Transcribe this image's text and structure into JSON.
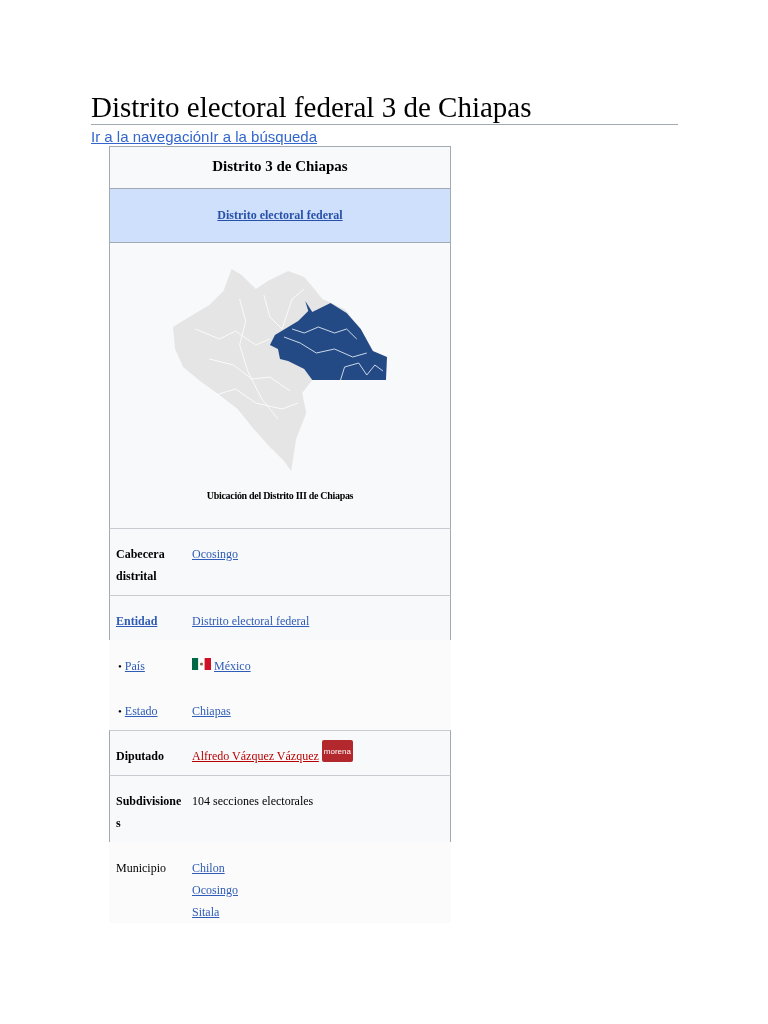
{
  "page": {
    "title": "Distrito electoral federal 3 de Chiapas",
    "skip_links": [
      "Ir a la navegación",
      "Ir a la búsqueda"
    ]
  },
  "infobox": {
    "title": "Distrito 3 de Chiapas",
    "subtitle_link": "Distrito electoral federal",
    "map": {
      "caption": "Ubicación del Distrito III de Chiapas"
    },
    "rows": [
      {
        "label": "Cabecera distrital",
        "kind": "bold",
        "framed": true,
        "values": [
          {
            "text": "Ocosingo",
            "kind": "link"
          }
        ]
      },
      {
        "label": "Entidad",
        "kind": "boldlink",
        "framed": true,
        "values": [
          {
            "text": "Distrito electoral federal",
            "kind": "link"
          }
        ]
      },
      {
        "bullet": "•",
        "label": "País",
        "kind": "link",
        "framed": false,
        "values": [
          {
            "text": "México",
            "kind": "link",
            "flag": true
          }
        ]
      },
      {
        "bullet": "•",
        "label": "Estado",
        "kind": "link",
        "framed": false,
        "values": [
          {
            "text": "Chiapas",
            "kind": "link"
          }
        ]
      },
      {
        "label": "Diputado",
        "kind": "bold",
        "framed": true,
        "values": [
          {
            "text": "Alfredo Vázquez Vázquez",
            "kind": "redlink",
            "logo": "morena"
          }
        ]
      },
      {
        "label": "Subdivisiones",
        "kind": "bold",
        "framed": true,
        "values": [
          {
            "text": "104 secciones electorales",
            "kind": "text"
          }
        ]
      },
      {
        "label": "Municipio",
        "kind": "plain",
        "framed": false,
        "values": [
          {
            "text": "Chilon",
            "kind": "link"
          },
          {
            "text": "Ocosingo",
            "kind": "link"
          },
          {
            "text": "Sitala",
            "kind": "link"
          }
        ]
      }
    ]
  }
}
